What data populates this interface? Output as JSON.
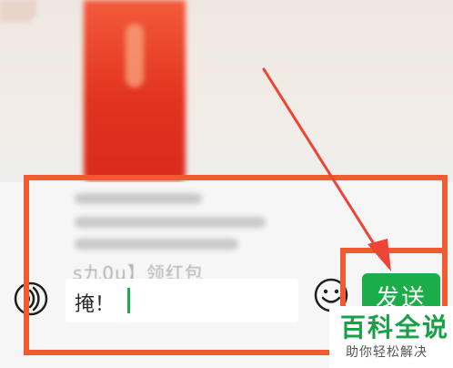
{
  "chat": {
    "quoted_text": "s九0u】领红包"
  },
  "input": {
    "typed_text": "掩！"
  },
  "toolbar": {
    "voice_icon": "voice-icon",
    "emoji_icon": "emoji-icon",
    "send_label": "发送"
  },
  "watermark": {
    "title": "百科全说",
    "subtitle": "助你轻松解决"
  },
  "colors": {
    "send_green": "#1aad4a",
    "annotation_orange": "#f15a32",
    "caret_green": "#1fa757",
    "watermark_green": "#1aa049"
  }
}
